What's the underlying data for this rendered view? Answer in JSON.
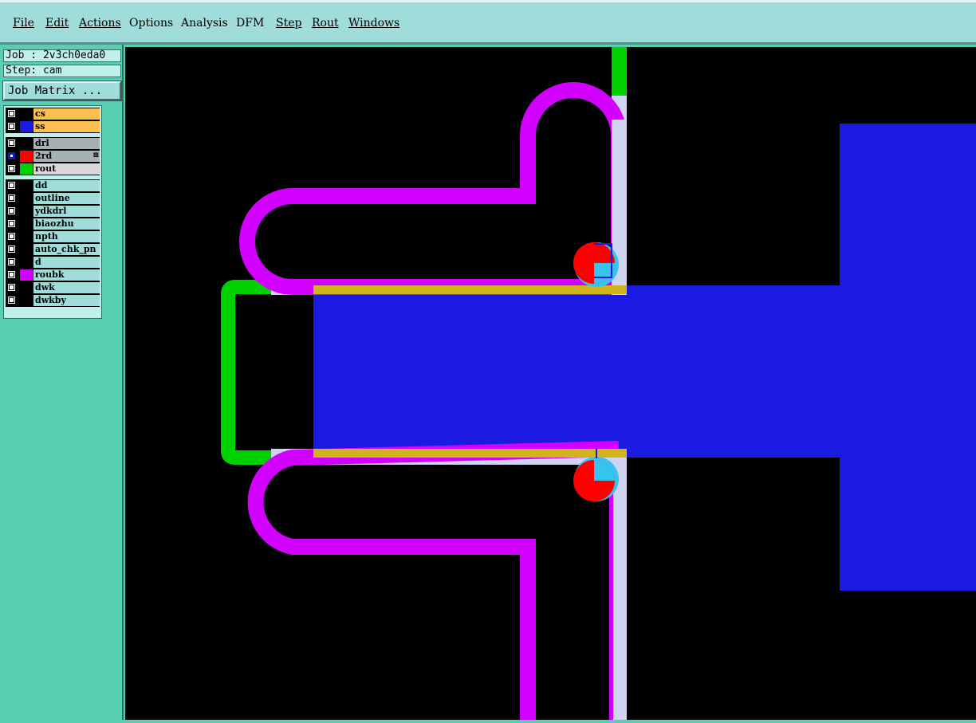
{
  "menubar": {
    "items": [
      {
        "label": "File"
      },
      {
        "label": "Edit"
      },
      {
        "label": "Actions"
      },
      {
        "label": "Options"
      },
      {
        "label": "Analysis"
      },
      {
        "label": "DFM"
      },
      {
        "label": "Step"
      },
      {
        "label": "Rout"
      },
      {
        "label": "Windows"
      }
    ]
  },
  "panel": {
    "job_label": "Job : 2v3ch0eda0",
    "step_label": "Step: cam",
    "job_matrix_label": "Job Matrix ..."
  },
  "layers": [
    {
      "name": "cs",
      "color": "#000000",
      "bg": "#fbbf4f",
      "checked": false
    },
    {
      "name": "ss",
      "color": "#1a1ae0",
      "bg": "#fbbf4f",
      "checked": false
    },
    {
      "name": "drl",
      "color": "#000000",
      "bg": "#a6b1b5",
      "checked": false
    },
    {
      "name": "2rd",
      "color": "#ff0000",
      "bg": "#a6b1b5",
      "checked": true,
      "flag": "⊞"
    },
    {
      "name": "rout",
      "color": "#00d200",
      "bg": "#d8d8d8",
      "checked": false
    },
    {
      "name": "dd",
      "color": "#000000",
      "bg": "#9fdcda",
      "checked": false
    },
    {
      "name": "outline",
      "color": "#000000",
      "bg": "#9fdcda",
      "checked": false
    },
    {
      "name": "ydkdrl",
      "color": "#000000",
      "bg": "#9fdcda",
      "checked": false
    },
    {
      "name": "biaozhu",
      "color": "#000000",
      "bg": "#9fdcda",
      "checked": false
    },
    {
      "name": "npth",
      "color": "#000000",
      "bg": "#9fdcda",
      "checked": false
    },
    {
      "name": "auto_chk_pn",
      "color": "#000000",
      "bg": "#9fdcda",
      "checked": false
    },
    {
      "name": "d",
      "color": "#000000",
      "bg": "#9fdcda",
      "checked": false
    },
    {
      "name": "roubk",
      "color": "#d200ff",
      "bg": "#9fdcda",
      "checked": false
    },
    {
      "name": "dwk",
      "color": "#000000",
      "bg": "#9fdcda",
      "checked": false
    },
    {
      "name": "dwkby",
      "color": "#000000",
      "bg": "#9fdcda",
      "checked": false
    }
  ],
  "colors": {
    "canvas_bg": "#000000",
    "copper_blue": "#1a1ae0",
    "rout_green": "#00d200",
    "roubk_magenta": "#d200ff",
    "outline_lavender": "#cfd4f2",
    "trim_gold": "#d1b41c",
    "drill_red": "#ff0000",
    "drill_cyan": "#36c3ee"
  }
}
